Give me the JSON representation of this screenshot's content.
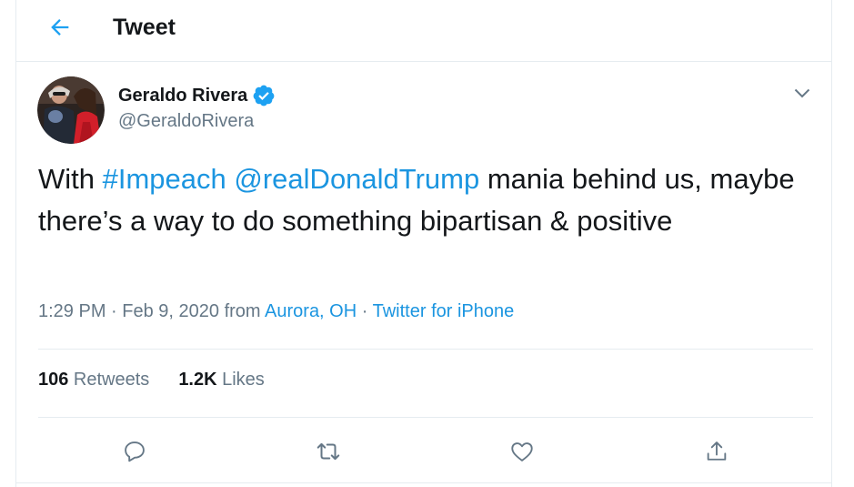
{
  "header": {
    "title": "Tweet",
    "back_icon": "arrow-left-icon"
  },
  "author": {
    "display_name": "Geraldo Rivera",
    "handle": "@GeraldoRivera",
    "verified": true
  },
  "tweet": {
    "text_prefix": "With ",
    "hashtag": "#Impeach",
    "space": " ",
    "mention": "@realDonaldTrump",
    "text_suffix": " mania behind us, maybe there’s a way to do something bipartisan & positive"
  },
  "meta": {
    "time": "1:29 PM",
    "sep1": " · ",
    "date": "Feb 9, 2020",
    "from_label": " from ",
    "location": "Aurora, OH",
    "sep2": " · ",
    "source": "Twitter for iPhone"
  },
  "stats": {
    "retweets_count": "106",
    "retweets_label": " Retweets",
    "likes_count": "1.2K",
    "likes_label": " Likes"
  },
  "actions": {
    "reply_icon": "reply-icon",
    "retweet_icon": "retweet-icon",
    "like_icon": "heart-icon",
    "share_icon": "share-icon"
  },
  "colors": {
    "accent": "#1da1f2",
    "link": "#1b95e0",
    "text": "#14171a",
    "secondary": "#657786",
    "border": "#e6ecf0"
  }
}
